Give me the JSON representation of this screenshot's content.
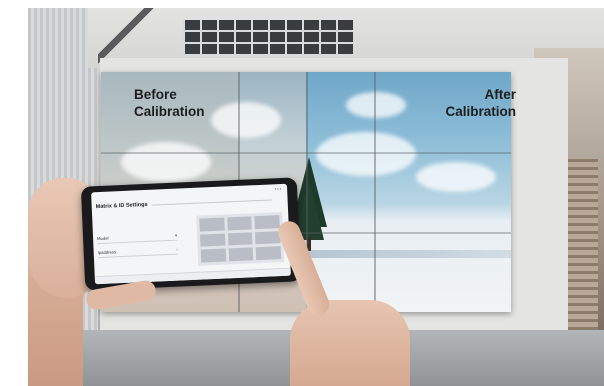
{
  "overlay_labels": {
    "before": "Before\nCalibration",
    "after": "After\nCalibration"
  },
  "phone_ui": {
    "title": "Matrix & ID Settings",
    "rows": [
      {
        "label": "Model",
        "value": ""
      },
      {
        "label": "Ipaddress",
        "value": ""
      }
    ],
    "grid_cells": [
      "",
      "",
      "",
      "",
      "",
      "",
      "",
      "",
      ""
    ]
  },
  "colors": {
    "label_text": "#1e1e1e",
    "phone_accent": "#2d6bd2"
  }
}
